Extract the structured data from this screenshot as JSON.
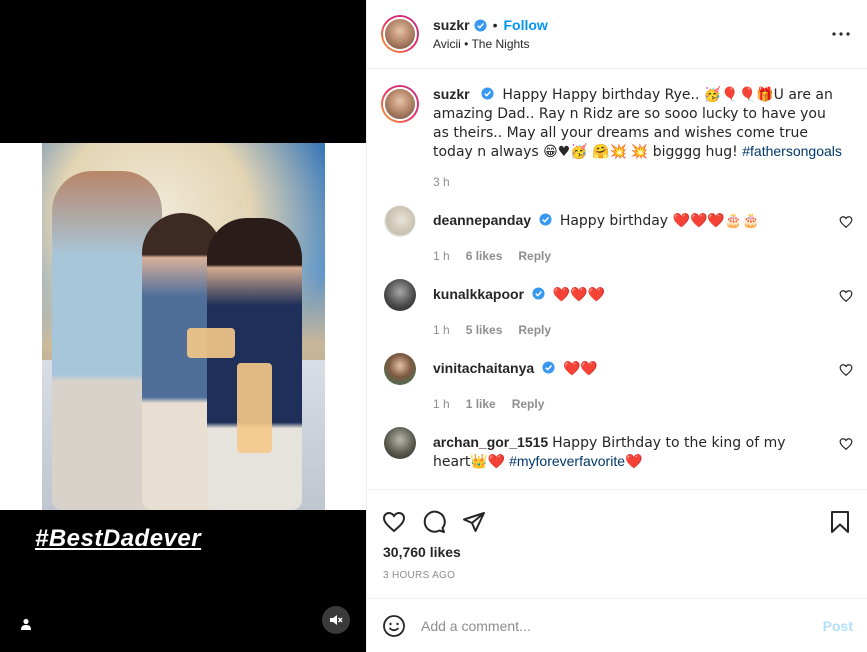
{
  "post": {
    "hashtag_overlay": "#BestDadever"
  },
  "header": {
    "username": "suzkr",
    "follow_label": "Follow",
    "dot": "•",
    "artist": "Avicii",
    "song": "The Nights",
    "more_icon": "more-horizontal-icon"
  },
  "caption": {
    "username": "suzkr",
    "text_part1": "Happy Happy birthday Rye.. 🥳🎈🎈🎁U are an amazing Dad.. Ray n Ridz are so sooo lucky to have you as theirs.. May all your dreams and wishes come true today n always 😁♥🥳 🤗💥",
    "text_part2": "💥 bigggg hug! ",
    "hashtag": "#fathersongoals",
    "time": "3 h"
  },
  "comments": [
    {
      "username": "deannepanday",
      "verified": true,
      "text": "Happy birthday ❤️❤️❤️🎂🎂",
      "time": "1 h",
      "likes": "6 likes",
      "reply": "Reply"
    },
    {
      "username": "kunalkkapoor",
      "verified": true,
      "text": "❤️❤️❤️",
      "time": "1 h",
      "likes": "5 likes",
      "reply": "Reply"
    },
    {
      "username": "vinitachaitanya",
      "verified": true,
      "text": "❤️❤️",
      "time": "1 h",
      "likes": "1 like",
      "reply": "Reply"
    },
    {
      "username": "archan_gor_1515",
      "verified": false,
      "text": "Happy Birthday to the king of my heart👑❤️",
      "hashtag": "#myforeverfavorite",
      "hashtag_suffix": "❤️"
    }
  ],
  "stats": {
    "likes": "30,760 likes",
    "time_ago": "3 HOURS AGO"
  },
  "add_comment": {
    "placeholder": "Add a comment...",
    "post_label": "Post"
  },
  "colors": {
    "link_blue": "#0095f6",
    "hashtag": "#00376b",
    "muted": "#8e8e8e"
  }
}
